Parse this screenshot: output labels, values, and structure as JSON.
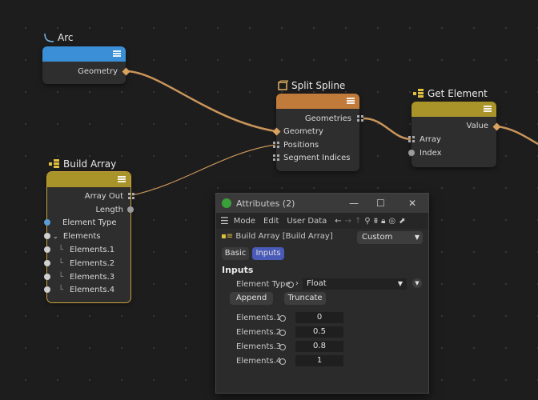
{
  "nodes": {
    "arc": {
      "title": "Arc",
      "color": "#3a8fd6",
      "outputs": [
        "Geometry"
      ]
    },
    "split_spline": {
      "title": "Split Spline",
      "color": "#c07a3a",
      "outputs": [
        "Geometries"
      ],
      "inputs": [
        "Geometry",
        "Positions",
        "Segment Indices"
      ]
    },
    "get_element": {
      "title": "Get Element",
      "color": "#a89428",
      "outputs": [
        "Value"
      ],
      "inputs": [
        "Array",
        "Index"
      ]
    },
    "build_array": {
      "title": "Build Array",
      "color": "#a89428",
      "outputs": [
        "Array Out",
        "Length"
      ],
      "inputs": [
        "Element Type",
        "Elements",
        "Elements.1",
        "Elements.2",
        "Elements.3",
        "Elements.4"
      ]
    }
  },
  "attributes": {
    "window_title": "Attributes (2)",
    "menu": [
      "Mode",
      "Edit",
      "User Data"
    ],
    "object_label": "Build Array [Build Array]",
    "preset": "Custom",
    "tabs": [
      "Basic",
      "Inputs"
    ],
    "active_tab": "Inputs",
    "section": "Inputs",
    "element_type_label": "Element Type",
    "element_type_value": "Float",
    "buttons": {
      "append": "Append",
      "truncate": "Truncate"
    },
    "elements": [
      {
        "label": "Elements.1",
        "value": "0"
      },
      {
        "label": "Elements.2",
        "value": "0.5"
      },
      {
        "label": "Elements.3",
        "value": "0.8"
      },
      {
        "label": "Elements.4",
        "value": "1"
      }
    ]
  },
  "colors": {
    "wire": "#c9955a",
    "accent_tab": "#4a5ab8"
  }
}
